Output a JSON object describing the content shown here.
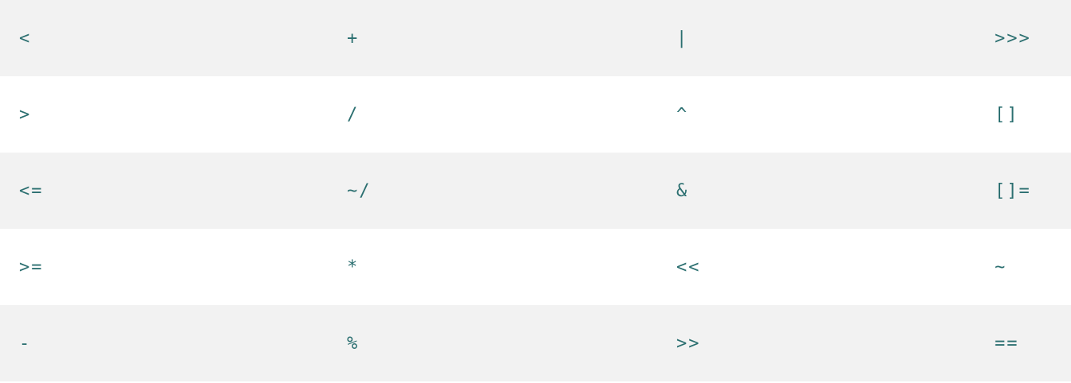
{
  "operators": {
    "rows": [
      [
        "<",
        "+",
        "|",
        ">>>"
      ],
      [
        ">",
        "/",
        "^",
        "[]"
      ],
      [
        "<=",
        "~/",
        "&",
        "[]="
      ],
      [
        ">=",
        "*",
        "<<",
        "~"
      ],
      [
        "-",
        "%",
        ">>",
        "=="
      ]
    ]
  },
  "colors": {
    "text": "#2b6f70",
    "stripe": "#f2f2f2",
    "background": "#ffffff"
  }
}
